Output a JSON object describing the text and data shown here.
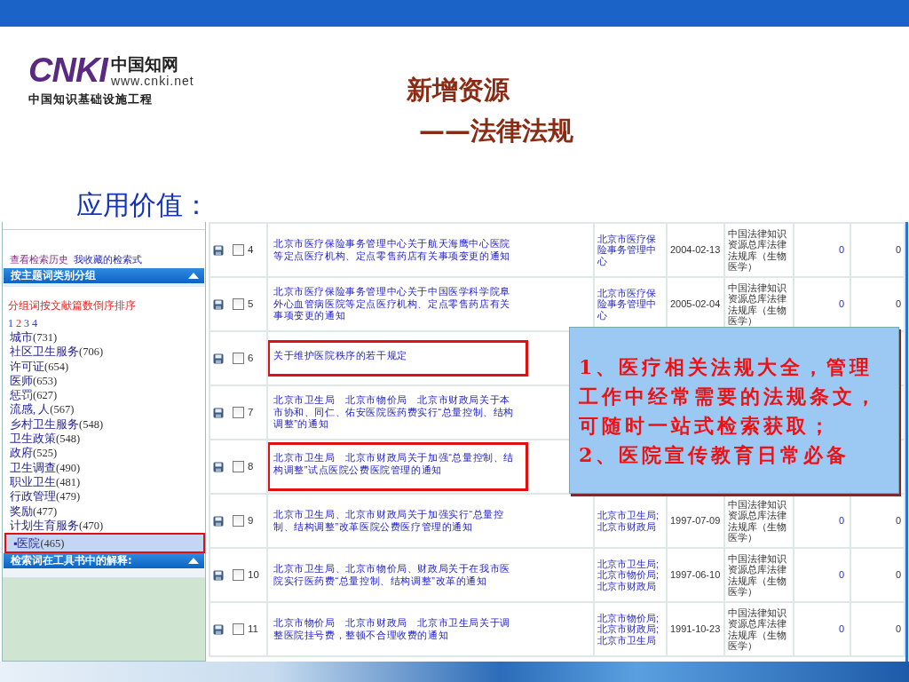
{
  "logo": {
    "mark": "CNKI",
    "name": "中国知网",
    "url": "www.cnki.net",
    "tagline": "中国知识基础设施工程"
  },
  "slide": {
    "title": "新增资源",
    "subtitle": "——法律法规",
    "section_heading": "应用价值："
  },
  "sidebar": {
    "links": [
      "查看检索历史",
      "我收藏的检索式"
    ],
    "group_panel": {
      "title": "按主题词类别分组",
      "expanded": true,
      "sort_note": "分组词按文献篇数倒序排序",
      "selected_marker": "▪",
      "pages": [
        {
          "label": "1",
          "selected": false
        },
        {
          "label": "2",
          "selected": true
        },
        {
          "label": "3",
          "selected": false
        },
        {
          "label": "4",
          "selected": false
        }
      ],
      "items": [
        {
          "label": "城市",
          "count": "(731)",
          "selected": false
        },
        {
          "label": "社区卫生服务",
          "count": "(706)",
          "selected": false
        },
        {
          "label": "许可证",
          "count": "(654)",
          "selected": false
        },
        {
          "label": "医师",
          "count": "(653)",
          "selected": false
        },
        {
          "label": "惩罚",
          "count": "(627)",
          "selected": false
        },
        {
          "label": "流感, 人",
          "count": "(567)",
          "selected": false
        },
        {
          "label": "乡村卫生服务",
          "count": "(548)",
          "selected": false
        },
        {
          "label": "卫生政策",
          "count": "(548)",
          "selected": false
        },
        {
          "label": "政府",
          "count": "(525)",
          "selected": false
        },
        {
          "label": "卫生调查",
          "count": "(490)",
          "selected": false
        },
        {
          "label": "职业卫生",
          "count": "(481)",
          "selected": false
        },
        {
          "label": "行政管理",
          "count": "(479)",
          "selected": false
        },
        {
          "label": "奖励",
          "count": "(477)",
          "selected": false
        },
        {
          "label": "计划生育服务",
          "count": "(470)",
          "selected": false
        },
        {
          "label": "医院",
          "count": "(465)",
          "selected": true
        }
      ]
    },
    "explain_panel": {
      "title": "检索词在工具书中的解释:",
      "expanded": true
    }
  },
  "table": {
    "rows": [
      {
        "number": "4",
        "checked": false,
        "highlighted": false,
        "title": "北京市医疗保险事务管理中心关于航天海鹰中心医院等定点医疗机构、定点零售药店有关事项变更的通知",
        "author": "北京市医疗保险事务管理中心",
        "date": "2004-02-13",
        "source": "中国法律知识资源总库法律法规库（生物医学）",
        "column_6": "0",
        "column_7": "0"
      },
      {
        "number": "5",
        "checked": false,
        "highlighted": false,
        "title": "北京市医疗保险事务管理中心关于中国医学科学院阜外心血管病医院等定点医疗机构、定点零售药店有关事项变更的通知",
        "author": "北京市医疗保险事务管理中心",
        "date": "2005-02-04",
        "source": "中国法律知识资源总库法律法规库（生物医学）",
        "column_6": "0",
        "column_7": "0"
      },
      {
        "number": "6",
        "checked": false,
        "highlighted": true,
        "title": "关于维护医院秩序的若干规定"
      },
      {
        "number": "7",
        "checked": false,
        "highlighted": false,
        "title": "北京市卫生局　北京市物价局　北京市财政局关于本市协和、同仁、佑安医院医药费实行“总量控制、结构调整”的通知"
      },
      {
        "number": "8",
        "checked": false,
        "highlighted": true,
        "title": "北京市卫生局　北京市财政局关于加强“总量控制、结构调整”试点医院公费医院管理的通知"
      },
      {
        "number": "9",
        "checked": false,
        "highlighted": false,
        "title": "北京市卫生局、北京市财政局关于加强实行“总量控制、结构调整”改革医院公费医疗管理的通知",
        "author": "北京市卫生局; 北京市财政局",
        "date": "1997-07-09",
        "source": "中国法律知识资源总库法律法规库（生物医学）",
        "column_6": "0",
        "column_7": "0"
      },
      {
        "number": "10",
        "checked": false,
        "highlighted": false,
        "title": "北京市卫生局、北京市物价局、财政局关于在我市医院实行医药费“总量控制、结构调整”改革的通知",
        "author": "北京市卫生局; 北京市物价局; 北京市财政局",
        "date": "1997-06-10",
        "source": "中国法律知识资源总库法律法规库（生物医学）",
        "column_6": "0",
        "column_7": "0"
      },
      {
        "number": "11",
        "checked": false,
        "highlighted": false,
        "title": "北京市物价局　北京市财政局　北京市卫生局关于调整医院挂号费，整顿不合理收费的通知",
        "author": "北京市物价局; 北京市财政局; 北京市卫生局",
        "date": "1991-10-23",
        "source": "中国法律知识资源总库法律法规库（生物医学）",
        "column_6": "0",
        "column_7": "0"
      }
    ]
  },
  "callout": {
    "paragraphs": [
      "1、医疗相关法规大全，管理工作中经常需要的法规条文，可随时一站式检索获取；",
      "2、医院宣传教育日常必备"
    ]
  }
}
